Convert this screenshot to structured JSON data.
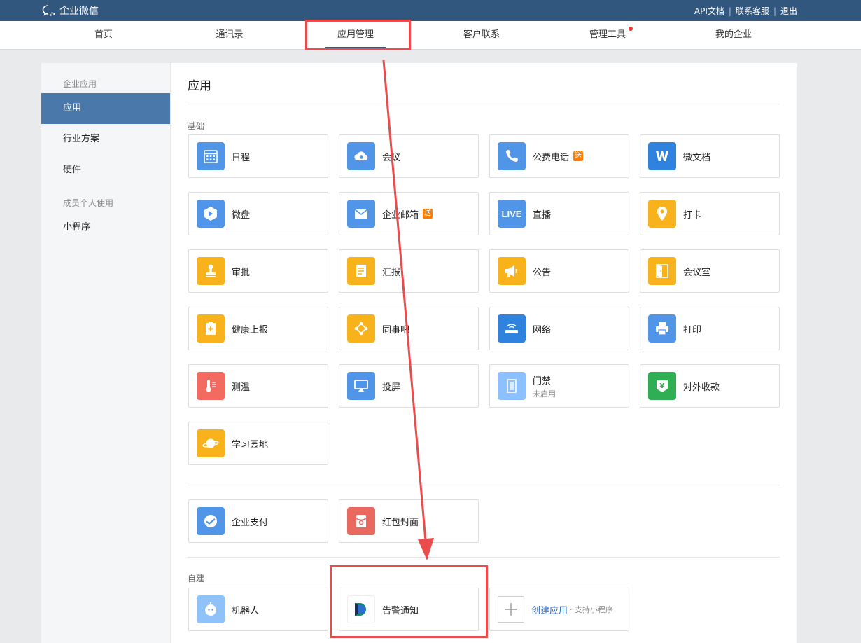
{
  "topbar": {
    "logo_text": "企业微信",
    "links": [
      "API文档",
      "联系客服",
      "退出"
    ]
  },
  "nav": {
    "items": [
      "首页",
      "通讯录",
      "应用管理",
      "客户联系",
      "管理工具",
      "我的企业"
    ],
    "active": "应用管理"
  },
  "sidebar": {
    "group1": "企业应用",
    "items1": [
      "应用",
      "行业方案",
      "硬件"
    ],
    "group2": "成员个人使用",
    "items2": [
      "小程序"
    ]
  },
  "main": {
    "title": "应用",
    "section_basic": "基础",
    "section_custom": "自建",
    "apps": [
      {
        "label": "日程",
        "icon": "calendar-icon"
      },
      {
        "label": "会议",
        "icon": "cloud-icon"
      },
      {
        "label": "公费电话",
        "badge": "送",
        "icon": "phone-icon"
      },
      {
        "label": "微文档",
        "icon": "document-w-icon"
      },
      {
        "label": "微盘",
        "icon": "drive-icon"
      },
      {
        "label": "企业邮箱",
        "badge": "送",
        "icon": "mail-icon"
      },
      {
        "label": "直播",
        "icon": "live-icon",
        "icon_text": "LIVE"
      },
      {
        "label": "打卡",
        "icon": "location-pin-icon"
      },
      {
        "label": "审批",
        "icon": "stamp-icon"
      },
      {
        "label": "汇报",
        "icon": "report-icon"
      },
      {
        "label": "公告",
        "icon": "megaphone-icon"
      },
      {
        "label": "会议室",
        "icon": "door-icon"
      },
      {
        "label": "健康上报",
        "icon": "health-clipboard-icon"
      },
      {
        "label": "同事吧",
        "icon": "network-icon"
      },
      {
        "label": "网络",
        "icon": "wifi-router-icon"
      },
      {
        "label": "打印",
        "icon": "printer-icon"
      },
      {
        "label": "测温",
        "icon": "thermometer-icon"
      },
      {
        "label": "投屏",
        "icon": "screen-cast-icon"
      },
      {
        "label": "门禁",
        "sub": "未启用",
        "icon": "access-door-icon"
      },
      {
        "label": "对外收款",
        "icon": "yuan-payment-icon"
      },
      {
        "label": "学习园地",
        "icon": "planet-icon"
      }
    ],
    "apps2": [
      {
        "label": "企业支付",
        "icon": "payment-icon"
      },
      {
        "label": "红包封面",
        "icon": "red-packet-icon"
      }
    ],
    "custom_apps": [
      {
        "label": "机器人",
        "icon": "robot-icon"
      },
      {
        "label": "告警通知",
        "icon": "alert-app-icon"
      }
    ],
    "create": {
      "label": "创建应用",
      "note": "· 支持小程序"
    }
  },
  "colors": {
    "topbar": "#32577e",
    "sidebar_active": "#4b78aa",
    "annotation": "#ea4b4b",
    "badge": "#ff7d00"
  }
}
